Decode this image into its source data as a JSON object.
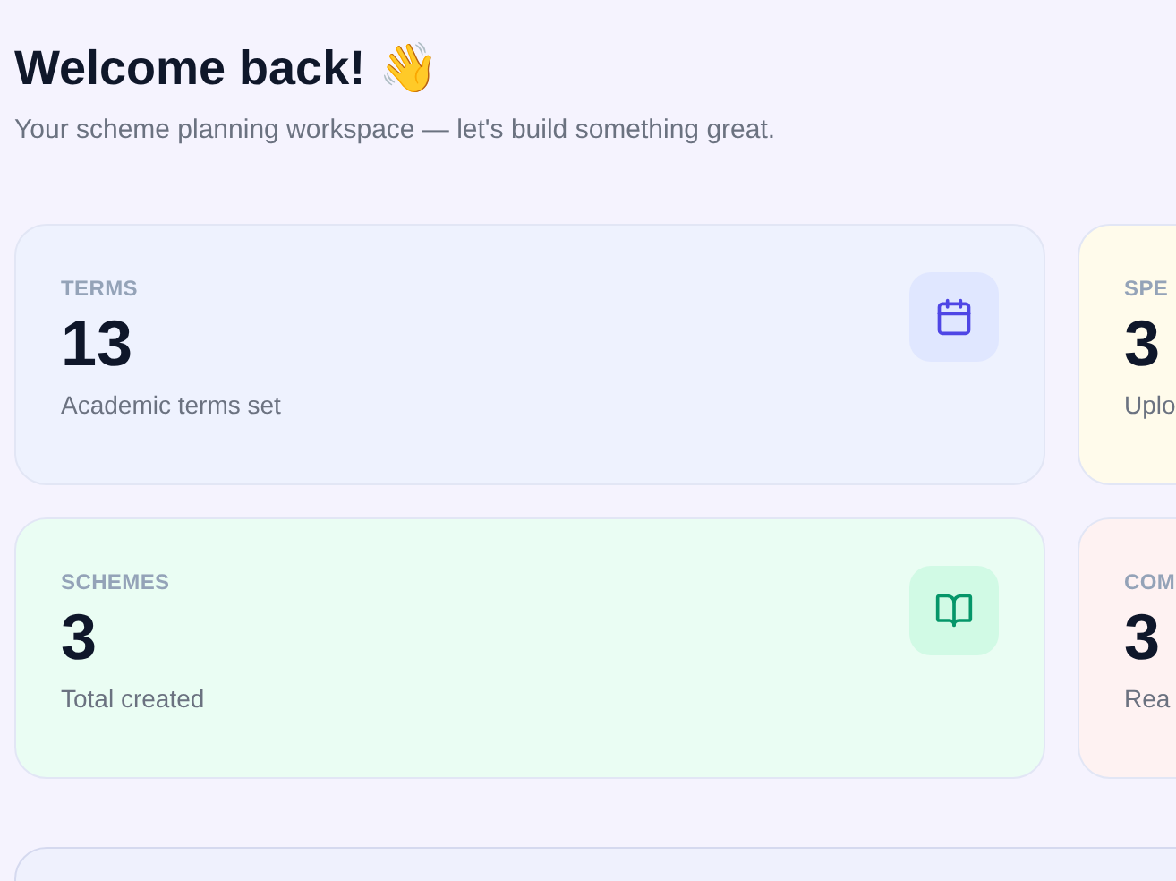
{
  "header": {
    "title": "Welcome back! 👋",
    "subtitle": "Your scheme planning workspace — let's build something great."
  },
  "stats": [
    {
      "label": "TERMS",
      "value": "13",
      "caption": "Academic terms set",
      "kind": "calendar",
      "color": "#eef2fe"
    },
    {
      "label": "SPE",
      "value": "3",
      "caption": "Uplo",
      "kind": "none",
      "color": "#fffbeb"
    },
    {
      "label": "SCHEMES",
      "value": "3",
      "caption": "Total created",
      "kind": "book",
      "color": "#eafdf3"
    },
    {
      "label": "COM",
      "value": "3",
      "caption": "Rea",
      "kind": "none",
      "color": "#fef2f2"
    }
  ]
}
